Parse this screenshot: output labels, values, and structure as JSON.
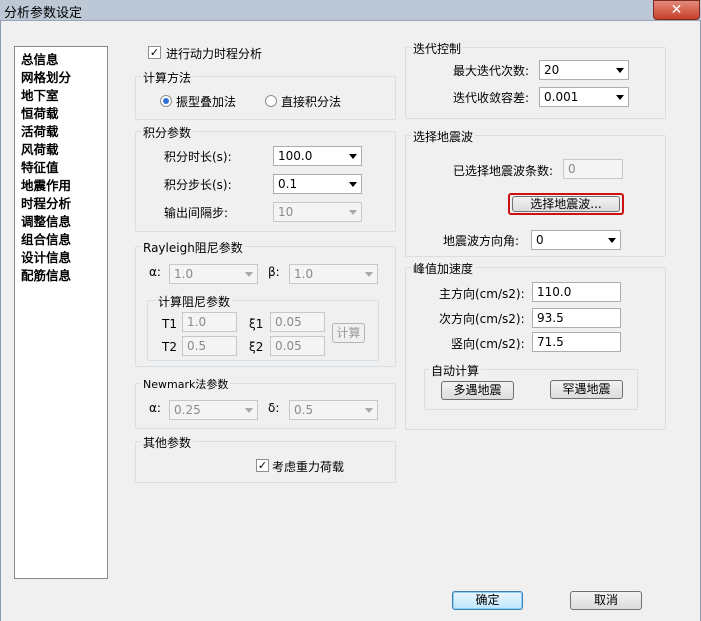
{
  "window": {
    "title": "分析参数设定",
    "close": "✕"
  },
  "nav": {
    "items": [
      "总信息",
      "网格划分",
      "地下室",
      "恒荷载",
      "活荷载",
      "风荷载",
      "特征值",
      "地震作用",
      "时程分析",
      "调整信息",
      "组合信息",
      "设计信息",
      "配筋信息"
    ]
  },
  "dynamic": {
    "label": "进行动力时程分析",
    "checked": "✓"
  },
  "method": {
    "title": "计算方法",
    "option1": "振型叠加法",
    "option2": "直接积分法"
  },
  "integration": {
    "title": "积分参数",
    "duration_label": "积分时长(s):",
    "duration_value": "100.0",
    "step_label": "积分步长(s):",
    "step_value": "0.1",
    "output_label": "输出间隔步:",
    "output_value": "10"
  },
  "rayleigh": {
    "title": "Rayleigh阻尼参数",
    "alpha_label": "α:",
    "alpha_value": "1.0",
    "beta_label": "β:",
    "beta_value": "1.0",
    "calc_title": "计算阻尼参数",
    "t1_label": "T1",
    "t1_value": "1.0",
    "xi1_label": "ξ1",
    "xi1_value": "0.05",
    "t2_label": "T2",
    "t2_value": "0.5",
    "xi2_label": "ξ2",
    "xi2_value": "0.05",
    "calc_button": "计算"
  },
  "newmark": {
    "title": "Newmark法参数",
    "alpha_label": "α:",
    "alpha_value": "0.25",
    "delta_label": "δ:",
    "delta_value": "0.5"
  },
  "other": {
    "title": "其他参数",
    "gravity_label": "考虑重力荷载",
    "checked": "✓"
  },
  "iteration": {
    "title": "迭代控制",
    "max_label": "最大迭代次数:",
    "max_value": "20",
    "tol_label": "迭代收敛容差:",
    "tol_value": "0.001"
  },
  "wave": {
    "title": "选择地震波",
    "count_label": "已选择地震波条数:",
    "count_value": "0",
    "select_button": "选择地震波...",
    "direction_label": "地震波方向角:",
    "direction_value": "0",
    "highlight_color": "#cc1111"
  },
  "peak": {
    "title": "峰值加速度",
    "main_label": "主方向(cm/s2):",
    "main_value": "110.0",
    "second_label": "次方向(cm/s2):",
    "second_value": "93.5",
    "vertical_label": "竖向(cm/s2):",
    "vertical_value": "71.5",
    "auto_title": "自动计算",
    "frequent_button": "多遇地震",
    "rare_button": "罕遇地震"
  },
  "footer": {
    "ok": "确定",
    "cancel": "取消"
  }
}
